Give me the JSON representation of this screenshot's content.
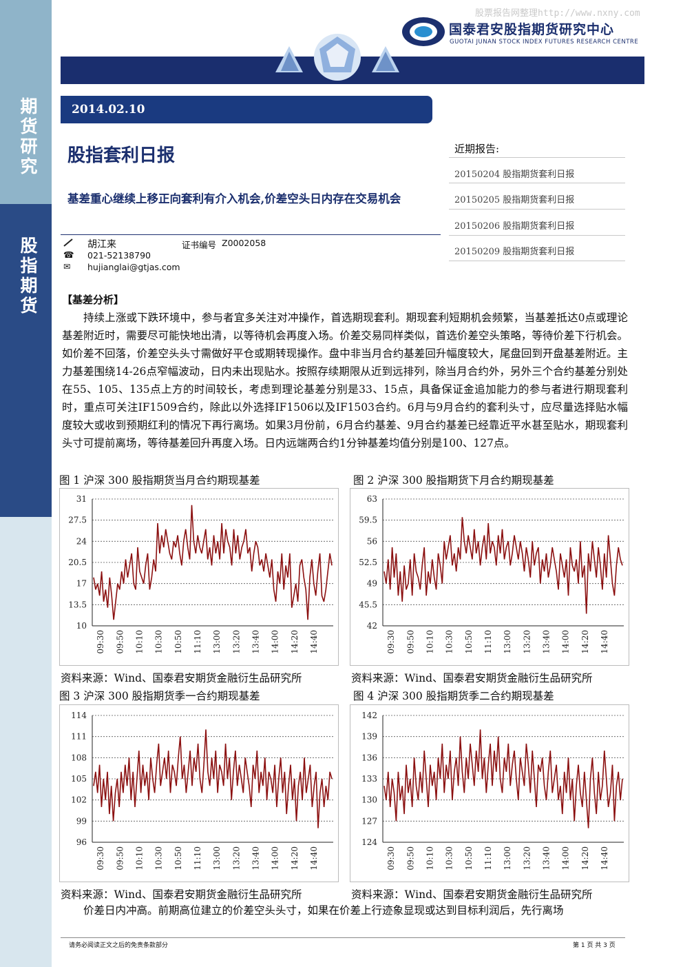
{
  "watermark": "股票报告网整理http://www.nxny.com",
  "brand": {
    "cn": "国泰君安股指期货研究中心",
    "en": "GUOTAI JUNAN STOCK INDEX FUTURES RESEARCH CENTRE",
    "accent": "#1b2f6e"
  },
  "sidebar": {
    "top_label": "期货研究",
    "mid_label": "股指期货"
  },
  "date": "2014.02.10",
  "title": "股指套利日报",
  "headline": "基差重心继续上移正向套利有介入机会,价差空头日内存在交易机会",
  "author": {
    "name": "胡江来",
    "cert_label": "证书编号",
    "cert_no": "Z0002058",
    "phone": "021-52138790",
    "email": "hujianglai@gtjas.com"
  },
  "recent": {
    "title": "近期报告:",
    "items": [
      "20150204 股指期货套利日报",
      "20150205 股指期货套利日报",
      "20150206 股指期货套利日报",
      "20150209 股指期货套利日报"
    ]
  },
  "section_head": "【基差分析】",
  "body": "持续上涨或下跌环境中，参与者宜多关注对冲操作，首选期现套利。期现套利短期机会频繁，当基差抵达0点或理论基差附近时，需要尽可能快地出清，以等待机会再度入场。价差交易同样类似，首选价差空头策略，等待价差下行机会。如价差不回落，价差空头头寸需做好平仓或期转现操作。盘中非当月合约基差回升幅度较大，尾盘回到开盘基差附近。主力基差围绕14-26点窄幅波动，日内未出现贴水。按照存续期限从近到远排列，除当月合约外，另外三个合约基差分别处在55、105、135点上方的时间较长，考虑到理论基差分别是33、15点，具备保证金追加能力的参与者进行期现套利时，重点可关注IF1509合约，除此以外选择IF1506以及IF1503合约。6月与9月合约的套利头寸，应尽量选择贴水幅度较大或收到预期红利的情况下再行离场。如果3月份前，6月合约基差、9月合约基差已经靠近平水甚至贴水，期现套利头寸可提前离场，等待基差回升再度入场。日内远端两合约1分钟基差均值分别是100、127点。",
  "source_text": "资料来源：Wind、国泰君安期货金融衍生品研究所",
  "bottom_text": "价差日内冲高。前期高位建立的价差空头头寸，如果在价差上行迹象显现或达到目标利润后，先行离场",
  "footer": {
    "left": "请务必阅读正文之后的免责条款部分",
    "right": "第 1 页 共 3 页"
  },
  "chart_data": [
    {
      "type": "line",
      "title": "图 1 沪深 300 股指期货当月合约期现基差",
      "yticks": [
        "31",
        "27.5",
        "24",
        "20.5",
        "17",
        "13.5",
        "10"
      ],
      "ylim": [
        10,
        31
      ],
      "xticks": [
        "09:30",
        "09:50",
        "10:10",
        "10:30",
        "10:50",
        "11:10",
        "13:00",
        "13:20",
        "13:40",
        "14:00",
        "14:20",
        "14:40"
      ],
      "values": [
        18,
        16,
        17,
        15,
        19,
        14,
        16,
        13,
        18,
        15,
        11,
        14,
        17,
        16,
        19,
        17,
        21,
        18,
        20,
        22,
        17,
        16,
        23,
        19,
        18,
        17,
        20,
        22,
        16,
        18,
        21,
        19,
        27,
        22,
        25,
        23,
        26,
        24,
        22,
        21,
        24,
        23,
        25,
        22,
        20,
        24,
        26,
        23,
        21,
        30,
        24,
        22,
        25,
        23,
        22,
        24,
        26,
        21,
        23,
        20,
        25,
        22,
        24,
        21,
        27,
        22,
        26,
        24,
        23,
        20,
        26,
        22,
        25,
        21,
        23,
        24,
        26,
        22,
        23,
        19,
        22,
        24,
        23,
        20,
        21,
        19,
        22,
        20,
        18,
        21,
        16,
        14,
        19,
        17,
        22,
        16,
        20,
        18,
        22,
        13,
        15,
        17,
        14,
        20,
        21,
        18,
        16,
        11,
        18,
        21,
        17,
        15,
        19,
        22,
        15,
        14,
        16,
        19,
        22,
        20
      ],
      "series_color": "#8b1010"
    },
    {
      "type": "line",
      "title": "图 2 沪深 300 股指期货下月合约期现基差",
      "yticks": [
        "63",
        "59.5",
        "56",
        "52.5",
        "49",
        "45.5",
        "42"
      ],
      "ylim": [
        42,
        63
      ],
      "xticks": [
        "09:30",
        "09:50",
        "10:10",
        "10:30",
        "10:50",
        "11:10",
        "13:00",
        "13:20",
        "13:40",
        "14:00",
        "14:20",
        "14:40"
      ],
      "values": [
        51,
        49,
        53,
        48,
        55,
        50,
        54,
        47,
        51,
        46,
        52,
        48,
        49,
        53,
        47,
        54,
        51,
        50,
        48,
        52,
        55,
        47,
        51,
        49,
        53,
        50,
        48,
        54,
        52,
        49,
        56,
        53,
        55,
        57,
        52,
        54,
        51,
        55,
        53,
        60,
        56,
        54,
        57,
        55,
        53,
        58,
        54,
        56,
        52,
        55,
        57,
        53,
        59,
        54,
        56,
        55,
        52,
        57,
        54,
        58,
        53,
        55,
        56,
        52,
        54,
        57,
        55,
        53,
        56,
        54,
        51,
        55,
        53,
        50,
        56,
        52,
        54,
        55,
        49,
        53,
        51,
        54,
        50,
        52,
        55,
        53,
        51,
        48,
        54,
        52,
        50,
        53,
        47,
        55,
        52,
        51,
        53,
        49,
        56,
        50,
        52,
        44,
        54,
        51,
        56,
        53,
        50,
        55,
        52,
        48,
        54,
        50,
        57,
        53,
        49,
        47,
        52,
        55,
        53,
        52
      ],
      "series_color": "#8b1010"
    },
    {
      "type": "line",
      "title": "图 3 沪深 300 股指期货季一合约期现基差",
      "yticks": [
        "114",
        "111",
        "108",
        "105",
        "102",
        "99",
        "96"
      ],
      "ylim": [
        96,
        114
      ],
      "xticks": [
        "09:30",
        "09:50",
        "10:10",
        "10:30",
        "10:50",
        "11:10",
        "13:00",
        "13:20",
        "13:40",
        "14:00",
        "14:20",
        "14:40"
      ],
      "values": [
        104,
        106,
        103,
        107,
        101,
        105,
        102,
        106,
        100,
        104,
        99,
        103,
        105,
        101,
        106,
        103,
        107,
        104,
        108,
        102,
        106,
        101,
        105,
        109,
        103,
        107,
        104,
        106,
        102,
        108,
        105,
        103,
        107,
        110,
        104,
        106,
        108,
        105,
        109,
        103,
        107,
        106,
        104,
        108,
        111,
        105,
        107,
        103,
        106,
        109,
        104,
        108,
        106,
        110,
        105,
        103,
        107,
        112,
        106,
        104,
        108,
        105,
        109,
        103,
        107,
        106,
        104,
        110,
        105,
        108,
        102,
        106,
        109,
        104,
        107,
        105,
        103,
        108,
        106,
        104,
        101,
        107,
        105,
        109,
        103,
        106,
        104,
        108,
        102,
        106,
        105,
        103,
        107,
        101,
        105,
        108,
        103,
        106,
        100,
        104,
        107,
        102,
        105,
        99,
        104,
        106,
        102,
        108,
        103,
        105,
        107,
        101,
        104,
        106,
        98,
        103,
        105,
        101,
        104,
        102,
        106,
        105
      ],
      "series_color": "#8b1010"
    },
    {
      "type": "line",
      "title": "图 4 沪深 300 股指期货季二合约期现基差",
      "yticks": [
        "142",
        "139",
        "136",
        "133",
        "130",
        "127",
        "124"
      ],
      "ylim": [
        124,
        142
      ],
      "xticks": [
        "09:30",
        "09:50",
        "10:10",
        "10:30",
        "10:50",
        "11:10",
        "13:00",
        "13:20",
        "13:40",
        "14:00",
        "14:20",
        "14:40"
      ],
      "values": [
        132,
        130,
        134,
        129,
        133,
        131,
        127,
        134,
        130,
        132,
        128,
        135,
        131,
        133,
        129,
        136,
        132,
        130,
        134,
        131,
        137,
        133,
        129,
        135,
        132,
        134,
        130,
        136,
        133,
        138,
        131,
        135,
        133,
        137,
        130,
        134,
        136,
        132,
        139,
        134,
        131,
        136,
        133,
        138,
        135,
        132,
        137,
        134,
        140,
        133,
        136,
        131,
        135,
        138,
        132,
        137,
        134,
        139,
        133,
        131,
        136,
        134,
        138,
        132,
        135,
        137,
        133,
        130,
        136,
        134,
        132,
        138,
        135,
        131,
        137,
        133,
        129,
        135,
        134,
        136,
        132,
        130,
        134,
        137,
        131,
        133,
        135,
        130,
        132,
        128,
        134,
        131,
        136,
        130,
        133,
        127,
        132,
        135,
        131,
        129,
        134,
        130,
        126,
        133,
        136,
        131,
        128,
        134,
        130,
        132,
        137,
        133,
        129,
        131,
        135,
        127,
        132,
        134,
        130,
        133
      ],
      "series_color": "#8b1010"
    }
  ]
}
